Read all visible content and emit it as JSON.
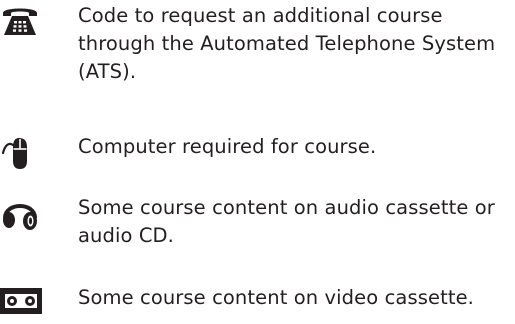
{
  "legend": {
    "items": [
      {
        "icon": "telephone-icon",
        "text": "Code to request an additional course\nthrough the Automated Telephone System\n(ATS)."
      },
      {
        "icon": "computer-mouse-icon",
        "text": "Computer required for course."
      },
      {
        "icon": "headphones-icon",
        "text": "Some course content on audio cassette or\naudio CD."
      },
      {
        "icon": "video-cassette-icon",
        "text": "Some course content on video cassette."
      }
    ]
  },
  "colors": {
    "ink": "#231f20",
    "background": "#ffffff"
  }
}
